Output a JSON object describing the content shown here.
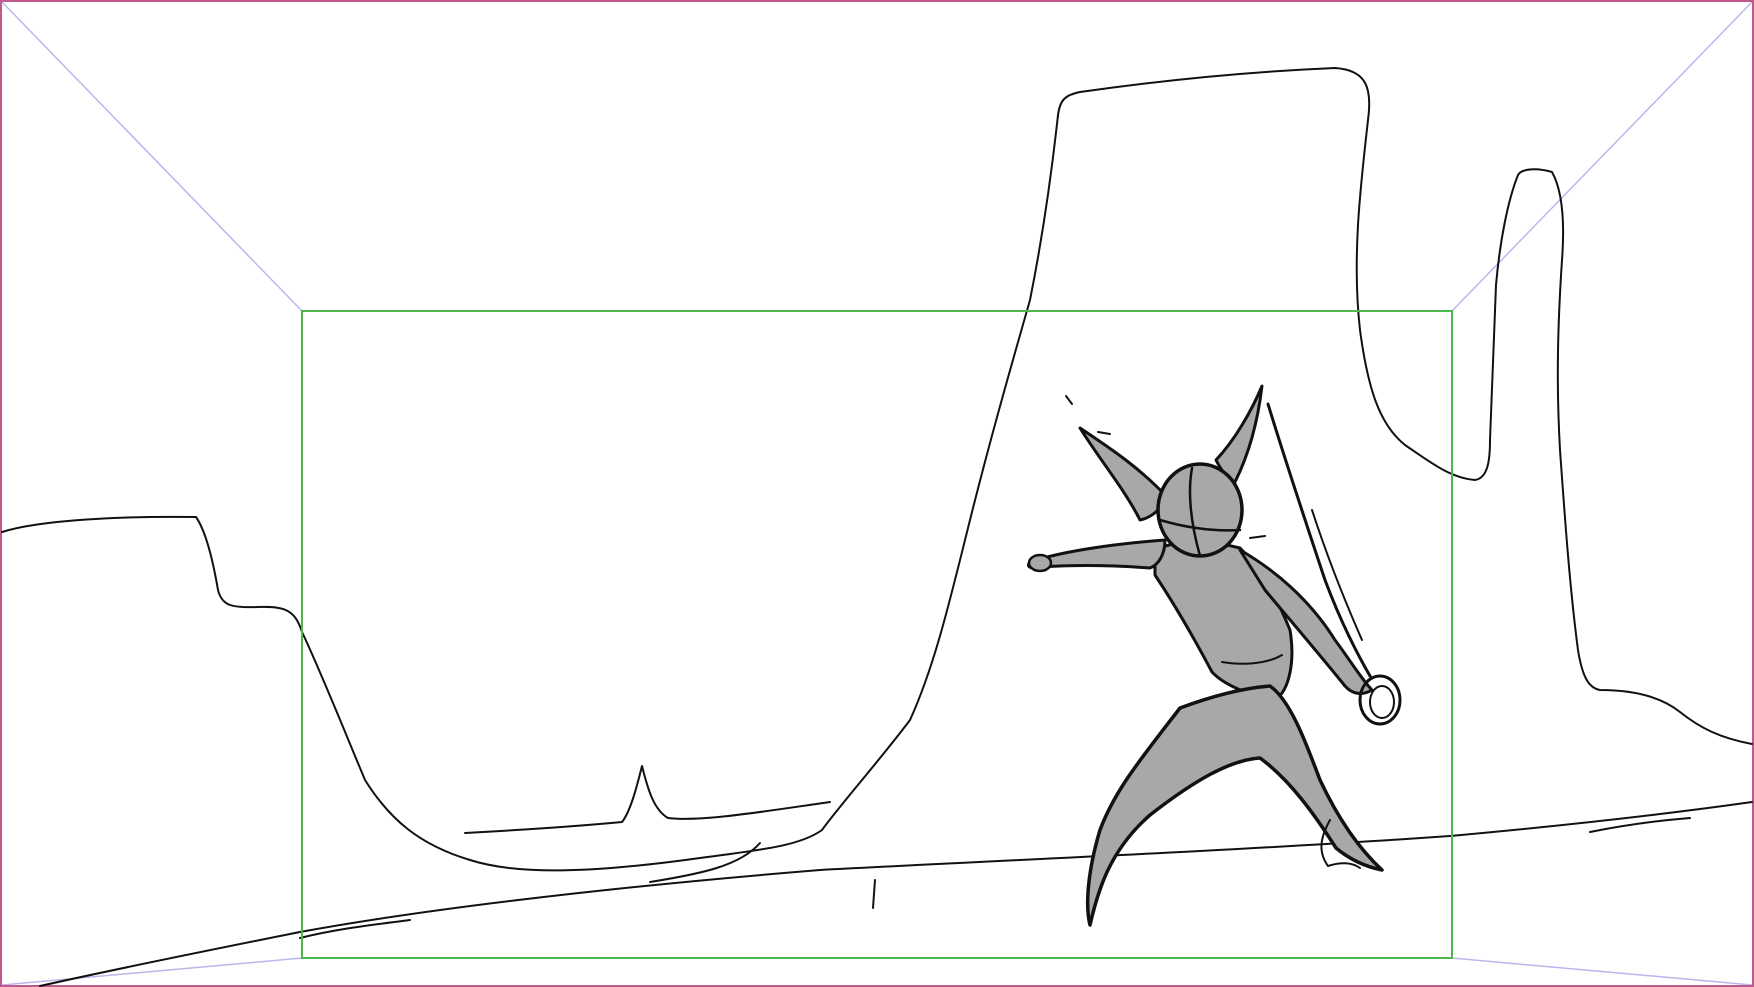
{
  "panel": {
    "colors": {
      "background": "#ffffff",
      "outer_border": "#c05a8c",
      "perspective_guide": "#b8b8ee",
      "safe_frame": "#4cb84c",
      "ink": "#111111",
      "figure_fill": "#a8a8a8"
    },
    "layers": [
      "camera-field-guides",
      "safe-frame",
      "background-rock-formations",
      "ground-line",
      "character-sketch"
    ],
    "subject": "horned-warrior-with-sword"
  }
}
